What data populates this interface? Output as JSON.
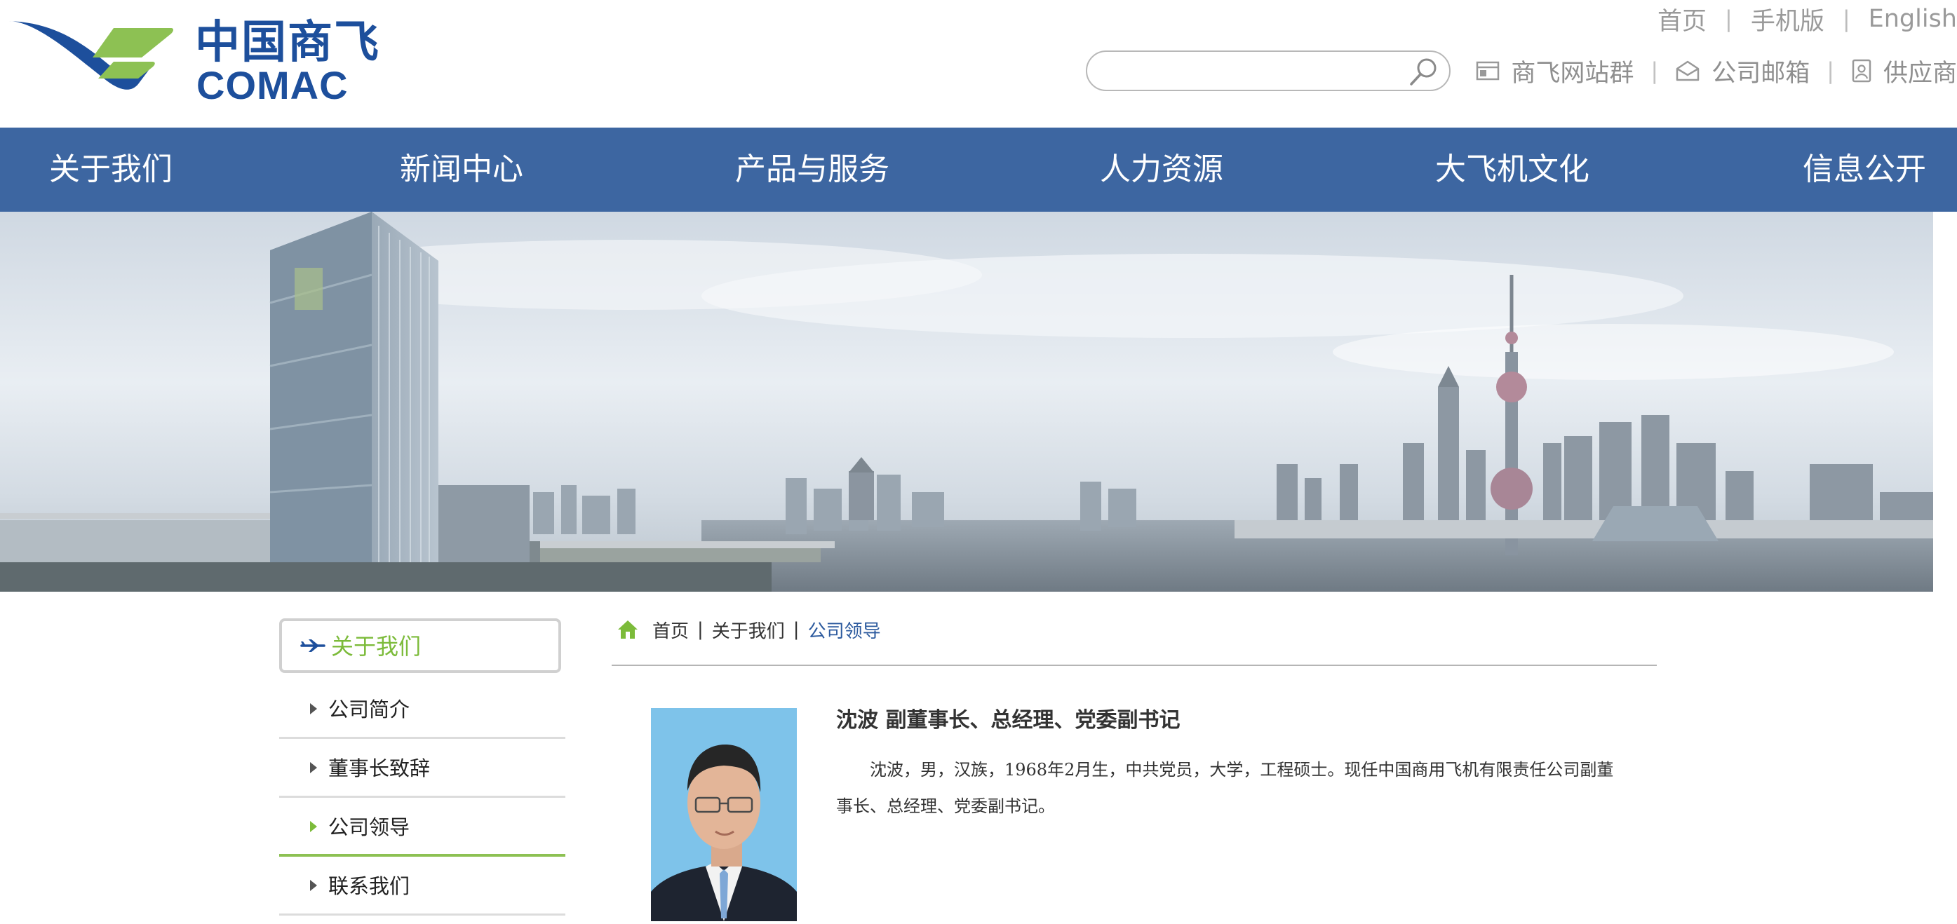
{
  "brand": {
    "name_cn": "中国商飞",
    "name_en": "COMAC",
    "colors": {
      "primary": "#1d4f9c",
      "green": "#7cbb3a",
      "nav": "#3d66a1"
    }
  },
  "top_links": [
    "首页",
    "手机版",
    "English"
  ],
  "search": {
    "placeholder": ""
  },
  "quick_links": [
    {
      "label": "商飞网站群",
      "icon": "website-group-icon"
    },
    {
      "label": "公司邮箱",
      "icon": "mail-icon"
    },
    {
      "label": "供应商",
      "icon": "supplier-icon"
    }
  ],
  "nav": [
    "关于我们",
    "新闻中心",
    "产品与服务",
    "人力资源",
    "大飞机文化",
    "信息公开"
  ],
  "sidebar": {
    "heading": "关于我们",
    "items": [
      {
        "label": "公司简介",
        "active": false
      },
      {
        "label": "董事长致辞",
        "active": false
      },
      {
        "label": "公司领导",
        "active": true
      },
      {
        "label": "联系我们",
        "active": false
      }
    ]
  },
  "breadcrumb": {
    "home": "首页",
    "section": "关于我们",
    "current": "公司领导"
  },
  "profile": {
    "title": "沈波 副董事长、总经理、党委副书记",
    "bio": "沈波，男，汉族，1968年2月生，中共党员，大学，工程硕士。现任中国商用飞机有限责任公司副董事长、总经理、党委副书记。"
  }
}
